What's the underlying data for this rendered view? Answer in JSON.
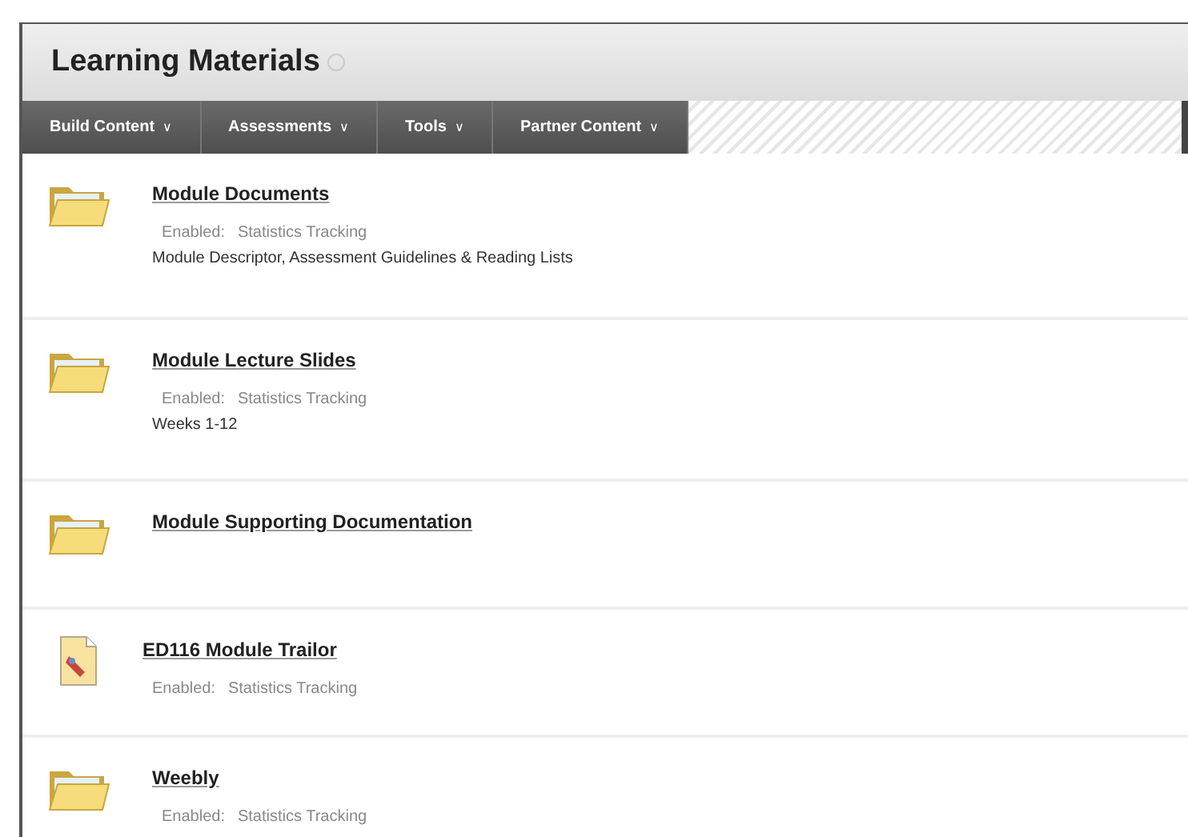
{
  "page": {
    "title": "Learning Materials"
  },
  "toolbar": [
    {
      "label": "Build Content",
      "caret": "∨"
    },
    {
      "label": "Assessments",
      "caret": "∨"
    },
    {
      "label": "Tools",
      "caret": "∨"
    },
    {
      "label": "Partner Content",
      "caret": "∨"
    }
  ],
  "items": [
    {
      "kind": "folder",
      "title": "Module Documents",
      "enabled_label": "Enabled:",
      "tracking": "Statistics Tracking",
      "description": "Module Descriptor, Assessment Guidelines & Reading Lists"
    },
    {
      "kind": "folder",
      "title": "Module Lecture Slides",
      "enabled_label": "Enabled:",
      "tracking": "Statistics Tracking",
      "description": "Weeks 1-12"
    },
    {
      "kind": "folder",
      "title": "Module Supporting Documentation"
    },
    {
      "kind": "file",
      "title": "ED116 Module Trailor",
      "enabled_label": "Enabled:",
      "tracking": "Statistics Tracking"
    },
    {
      "kind": "folder",
      "title": "Weebly",
      "enabled_label": "Enabled:",
      "tracking": "Statistics Tracking"
    }
  ]
}
